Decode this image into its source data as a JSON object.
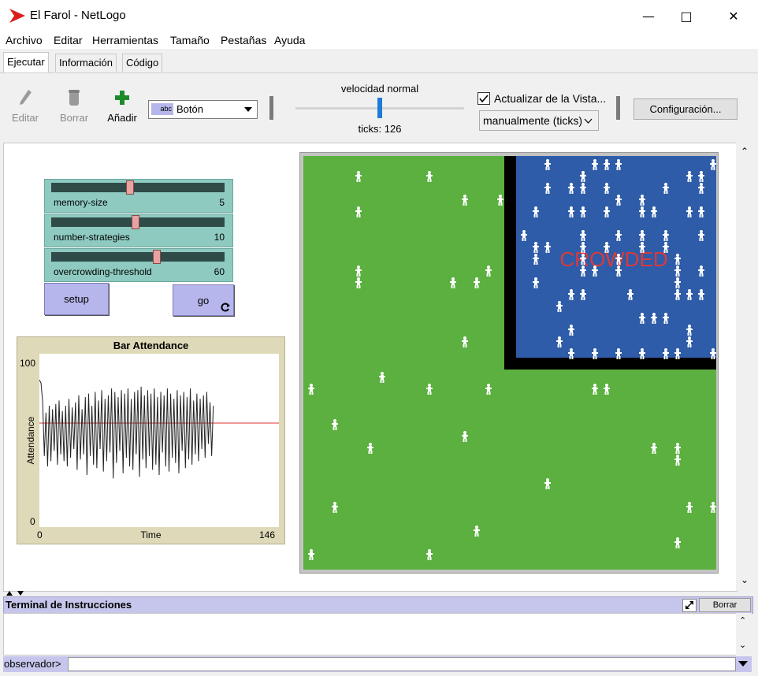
{
  "window": {
    "title": "El Farol - NetLogo"
  },
  "menu": [
    "Archivo",
    "Editar",
    "Herramientas",
    "Tamaño",
    "Pestañas",
    "Ayuda"
  ],
  "tabs": [
    "Ejecutar",
    "Información",
    "Código"
  ],
  "toolbar": {
    "edit_label": "Editar",
    "delete_label": "Borrar",
    "add_label": "Añadir",
    "widget_type": "Botón",
    "widget_type_badge": "abc",
    "speed_label": "velocidad normal",
    "speed_value": 0.5,
    "ticks_text": "ticks: 126",
    "update_view_label": "Actualizar de la Vista...",
    "update_view_checked": true,
    "update_mode": "manualmente (ticks)",
    "settings_label": "Configuración..."
  },
  "sliders": [
    {
      "name": "memory-size",
      "value": "5",
      "fraction": 0.45
    },
    {
      "name": "number-strategies",
      "value": "10",
      "fraction": 0.48
    },
    {
      "name": "overcrowding-threshold",
      "value": "60",
      "fraction": 0.61
    }
  ],
  "buttons": {
    "setup": "setup",
    "go": "go"
  },
  "plot": {
    "title": "Bar Attendance",
    "ylabel": "Attendance",
    "xlabel": "Time",
    "ymax": "100",
    "ymin": "0",
    "xmin": "0",
    "xmax": "146"
  },
  "chart_data": {
    "type": "line",
    "title": "Bar Attendance",
    "xlabel": "Time",
    "ylabel": "Attendance",
    "xlim": [
      0,
      146
    ],
    "ylim": [
      0,
      100
    ],
    "threshold": 60,
    "series": [
      {
        "values": [
          85,
          83,
          72,
          41,
          66,
          35,
          70,
          38,
          68,
          44,
          71,
          36,
          73,
          42,
          67,
          38,
          70,
          35,
          74,
          40,
          69,
          45,
          72,
          33,
          76,
          39,
          68,
          42,
          75,
          30,
          77,
          41,
          70,
          36,
          78,
          34,
          73,
          45,
          79,
          32,
          74,
          38,
          76,
          43,
          80,
          28,
          78,
          37,
          75,
          44,
          79,
          31,
          77,
          40,
          80,
          35,
          74,
          33,
          78,
          42,
          79,
          29,
          81,
          39,
          76,
          34,
          79,
          41,
          77,
          33,
          80,
          36,
          75,
          30,
          78,
          43,
          76,
          35,
          80,
          32,
          77,
          40,
          74,
          37,
          79,
          31,
          76,
          44,
          78,
          34,
          75,
          39,
          80,
          36,
          73,
          42,
          77,
          38,
          74,
          45,
          76,
          40,
          78,
          48,
          72,
          41,
          70
        ]
      }
    ]
  },
  "world": {
    "label": "CROWDED",
    "bg_color": "#5bb040",
    "bar_color": "#2f5ca8",
    "wall_color": "#000000",
    "label_color": "#d93a3a"
  },
  "terminal": {
    "title": "Terminal de Instrucciones",
    "clear_label": "Borrar",
    "prompt": "observador>"
  }
}
